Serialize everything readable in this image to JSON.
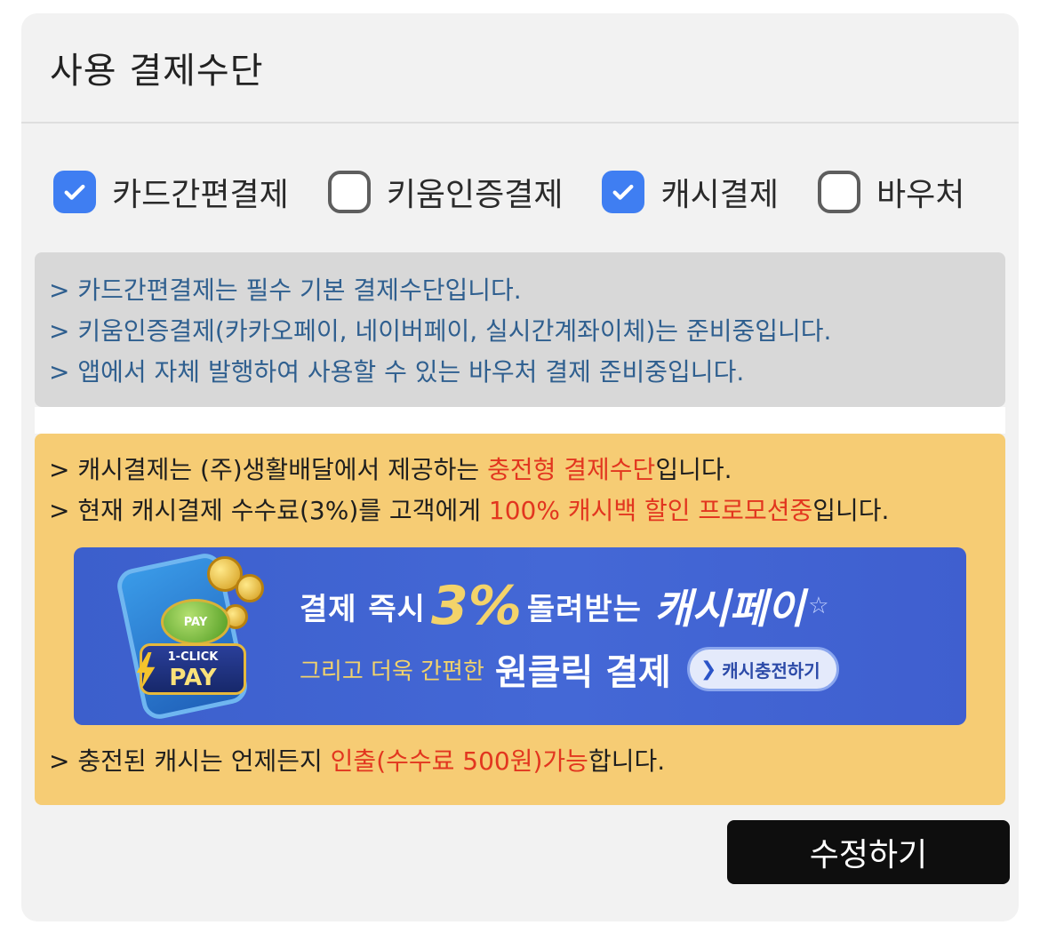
{
  "header": {
    "title": "사용 결제수단"
  },
  "methods": [
    {
      "label": "카드간편결제",
      "checked": true
    },
    {
      "label": "키움인증결제",
      "checked": false
    },
    {
      "label": "캐시결제",
      "checked": true
    },
    {
      "label": "바우처",
      "checked": false
    }
  ],
  "notice_gray": {
    "line1": "> 카드간편결제는 필수 기본 결제수단입니다.",
    "line2": "> 키움인증결제(카카오페이, 네이버페이, 실시간계좌이체)는 준비중입니다.",
    "line3": "> 앱에서 자체 발행하여 사용할 수 있는 바우처 결제 준비중입니다."
  },
  "notice_yellow": {
    "line1_a": "> 캐시결제는 (주)생활배달에서 제공하는 ",
    "line1_hl": "충전형 결제수단",
    "line1_b": "입니다.",
    "line2_a": "> 현재 캐시결제 수수료(3%)를 고객에게 ",
    "line2_hl": "100% 캐시백 할인 프로모션중",
    "line2_b": "입니다.",
    "line3_a": "> 충전된 캐시는 언제든지 ",
    "line3_hl": "인출(수수료 500원)가능",
    "line3_b": "합니다."
  },
  "banner": {
    "pay_button": "PAY",
    "one_click_small": "1-CLICK",
    "one_click_big": "PAY",
    "text_pre": "결제 즉시",
    "percent": "3%",
    "text_post": "돌려받는",
    "brand": "캐시페이",
    "sub_text": "그리고 더욱 간편한",
    "sub_bold": "원클릭 결제",
    "cta": "캐시충전하기"
  },
  "actions": {
    "edit_label": "수정하기"
  },
  "colors": {
    "accent_blue": "#3f7ef2",
    "highlight_red": "#e2361f",
    "notice_blue_text": "#2f5f8f",
    "yellow_bg": "#f6cc74"
  }
}
